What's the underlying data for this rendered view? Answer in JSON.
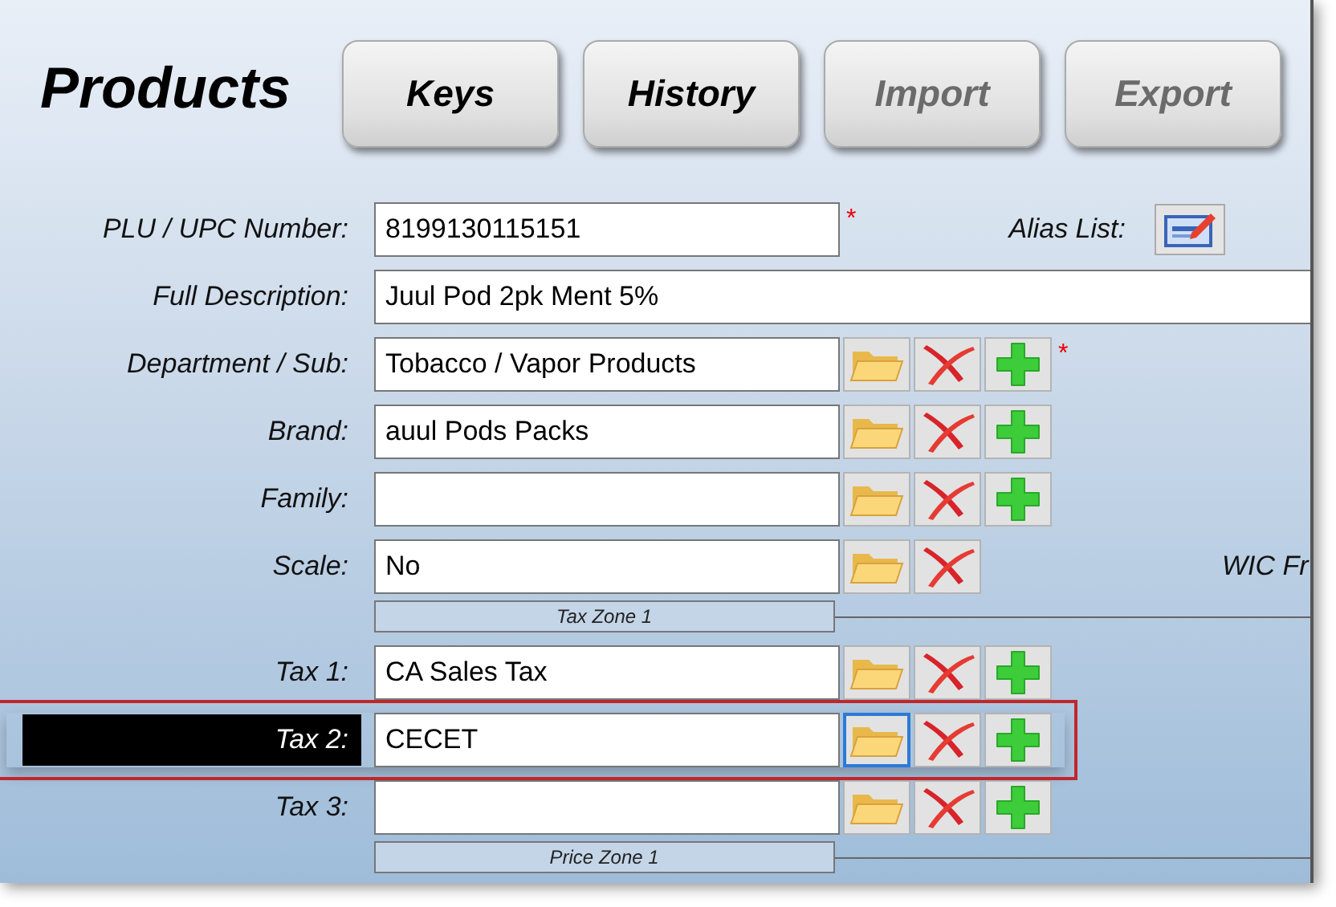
{
  "title": "Products",
  "toolbar": [
    {
      "label": "Keys",
      "disabled": false
    },
    {
      "label": "History",
      "disabled": false
    },
    {
      "label": "Import",
      "disabled": true
    },
    {
      "label": "Export",
      "disabled": true
    }
  ],
  "rows": [
    {
      "kind": "field",
      "label": "PLU / UPC Number:",
      "value": "8199130115151",
      "required_mark": "*",
      "selected": false,
      "side_label": "Alias List:"
    },
    {
      "kind": "wide",
      "label": "Full Description:",
      "value": "Juul Pod 2pk Ment 5%",
      "selected": false
    },
    {
      "kind": "lookup",
      "label": "Department / Sub:",
      "value": "Tobacco / Vapor Products",
      "required_mark": "*",
      "can_add": true,
      "selected": false
    },
    {
      "kind": "lookup",
      "label": "Brand:",
      "value": "auul Pods Packs",
      "can_add": true,
      "selected": false
    },
    {
      "kind": "lookup",
      "label": "Family:",
      "can_add": true,
      "selected": false
    },
    {
      "kind": "lookup",
      "label": "Scale:",
      "value": "No",
      "can_add": false,
      "selected": false,
      "side_label": "WIC Fr"
    },
    {
      "kind": "section",
      "label": "Tax Zone 1"
    },
    {
      "kind": "lookup",
      "label": "Tax 1:",
      "value": "CA Sales Tax",
      "can_add": true,
      "selected": false
    },
    {
      "kind": "lookup",
      "label": "Tax 2:",
      "value": "CECET",
      "can_add": true,
      "selected": true
    },
    {
      "kind": "lookup",
      "label": "Tax 3:",
      "can_add": true,
      "selected": false
    },
    {
      "kind": "section",
      "label": "Price Zone 1"
    }
  ]
}
